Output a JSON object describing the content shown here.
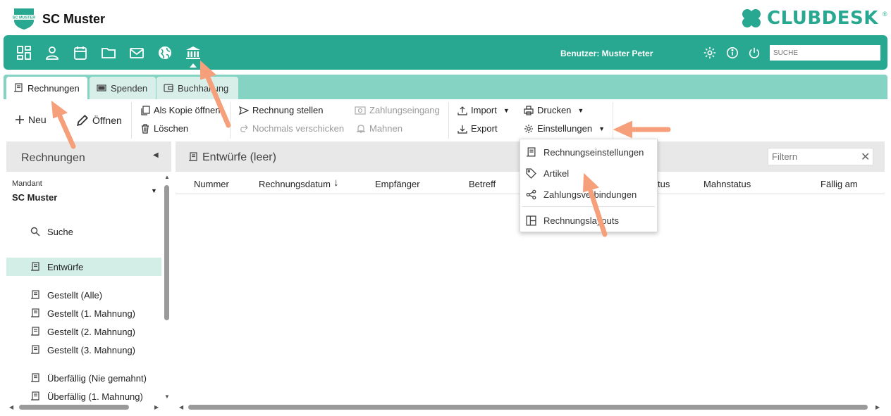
{
  "header": {
    "badge_text": "SC MUSTER",
    "club_name": "SC Muster",
    "brand": "CLUBDESK",
    "brand_reg": "®"
  },
  "topbar": {
    "icons": [
      "dashboard-icon",
      "person-icon",
      "calendar-icon",
      "folder-icon",
      "mail-icon",
      "globe-icon",
      "bank-icon"
    ],
    "user_label": "Benutzer: Muster Peter",
    "search_placeholder": "SUCHE"
  },
  "tabs": [
    {
      "label": "Rechnungen",
      "icon": "invoice-icon",
      "active": true
    },
    {
      "label": "Spenden",
      "icon": "donation-icon",
      "active": false
    },
    {
      "label": "Buchhaltung",
      "icon": "wallet-icon",
      "active": false
    }
  ],
  "actions": {
    "new": "Neu",
    "open": "Öffnen",
    "copy_open": "Als Kopie öffnen",
    "delete": "Löschen",
    "issue": "Rechnung stellen",
    "resend": "Nochmals verschicken",
    "payment_in": "Zahlungseingang",
    "dun": "Mahnen",
    "import": "Import",
    "export": "Export",
    "print": "Drucken",
    "settings": "Einstellungen"
  },
  "sidebar": {
    "title": "Rechnungen",
    "mandant_label": "Mandant",
    "mandant_value": "SC Muster",
    "items": [
      {
        "label": "Suche",
        "icon": "search-icon"
      },
      {
        "label": "Entwürfe",
        "icon": "invoice-icon",
        "selected": true
      },
      {
        "label": "Gestellt (Alle)",
        "icon": "invoice-icon"
      },
      {
        "label": "Gestellt (1. Mahnung)",
        "icon": "invoice-icon"
      },
      {
        "label": "Gestellt (2. Mahnung)",
        "icon": "invoice-icon"
      },
      {
        "label": "Gestellt (3. Mahnung)",
        "icon": "invoice-icon"
      },
      {
        "label": "Überfällig (Nie gemahnt)",
        "icon": "invoice-icon"
      },
      {
        "label": "Überfällig (1. Mahnung)",
        "icon": "invoice-icon"
      }
    ]
  },
  "main": {
    "title": "Entwürfe (leer)",
    "filter_placeholder": "Filtern",
    "columns": [
      "Nummer",
      "Rechnungsdatum",
      "Empfänger",
      "Betreff",
      "tus",
      "Mahnstatus",
      "Fällig am"
    ]
  },
  "dropdown": {
    "items": [
      {
        "label": "Rechnungseinstellungen",
        "icon": "invoice-icon"
      },
      {
        "label": "Artikel",
        "icon": "tag-icon"
      },
      {
        "label": "Zahlungsverbindungen",
        "icon": "share-icon"
      },
      {
        "label": "Rechnungslayouts",
        "icon": "layout-icon"
      }
    ]
  },
  "colors": {
    "teal": "#28a890",
    "tab_strip": "#85d3c3",
    "selected_row": "#d3eee7",
    "annotation_arrow": "#f5a07a"
  }
}
